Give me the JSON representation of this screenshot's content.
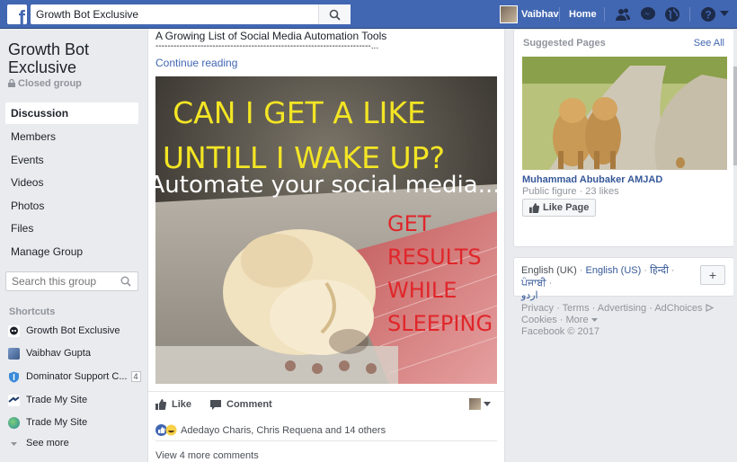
{
  "topbar": {
    "logo": "f",
    "search_value": "Growth Bot Exclusive",
    "user_name": "Vaibhav",
    "home_label": "Home",
    "icons": [
      "friend-requests-icon",
      "messages-icon",
      "notifications-globe-icon",
      "help-icon",
      "dropdown-caret-icon"
    ]
  },
  "group": {
    "title": "Growth Bot Exclusive",
    "type": "Closed group",
    "nav": [
      {
        "label": "Discussion",
        "active": true
      },
      {
        "label": "Members"
      },
      {
        "label": "Events"
      },
      {
        "label": "Videos"
      },
      {
        "label": "Photos"
      },
      {
        "label": "Files"
      },
      {
        "label": "Manage Group"
      }
    ],
    "search_placeholder": "Search this group"
  },
  "shortcuts": {
    "heading": "Shortcuts",
    "items": [
      {
        "label": "Growth Bot Exclusive",
        "icon": "skull-group-icon"
      },
      {
        "label": "Vaibhav Gupta",
        "icon": "profile-picture-icon"
      },
      {
        "label": "Dominator Support C...",
        "icon": "shield-group-icon",
        "badge": "4"
      },
      {
        "label": "Trade My Site",
        "icon": "trade-site-icon"
      },
      {
        "label": "Trade My Site",
        "icon": "globe-group-icon"
      }
    ],
    "see_more": "See more"
  },
  "post": {
    "text": "A Growing List of Social Media Automation Tools",
    "dashes": "------------------------------------------------------------------------...",
    "continue": "Continue reading",
    "image": {
      "line1": "CAN I GET A LIKE",
      "line2": "UNTILL I WAKE UP?",
      "line3": "Automate your social media...",
      "red_lines": [
        "GET",
        "RESULTS",
        "WHILE",
        "SLEEPING"
      ]
    },
    "like_label": "Like",
    "comment_label": "Comment",
    "reactions_text": "Adedayo Charis, Chris Requena and 14 others",
    "view_more": "View 4 more comments"
  },
  "suggested": {
    "heading": "Suggested Pages",
    "see_all": "See All",
    "page_name": "Muhammad Abubaker AMJAD",
    "page_sub": "Public figure · 23 likes",
    "like_page": "Like Page"
  },
  "languages": {
    "current": "English (UK)",
    "links": [
      "English (US)",
      "हिन्दी",
      "ਪੰਜਾਬੀ",
      "اردو"
    ],
    "plus": "+"
  },
  "footer": {
    "line1": "Privacy · Terms · Advertising · AdChoices",
    "line2": "Cookies · More",
    "line3": "Facebook © 2017"
  },
  "colors": {
    "brand": "#4267b2",
    "link": "#365899",
    "yellow_text": "#f3e524",
    "red_text": "#e0262a"
  }
}
